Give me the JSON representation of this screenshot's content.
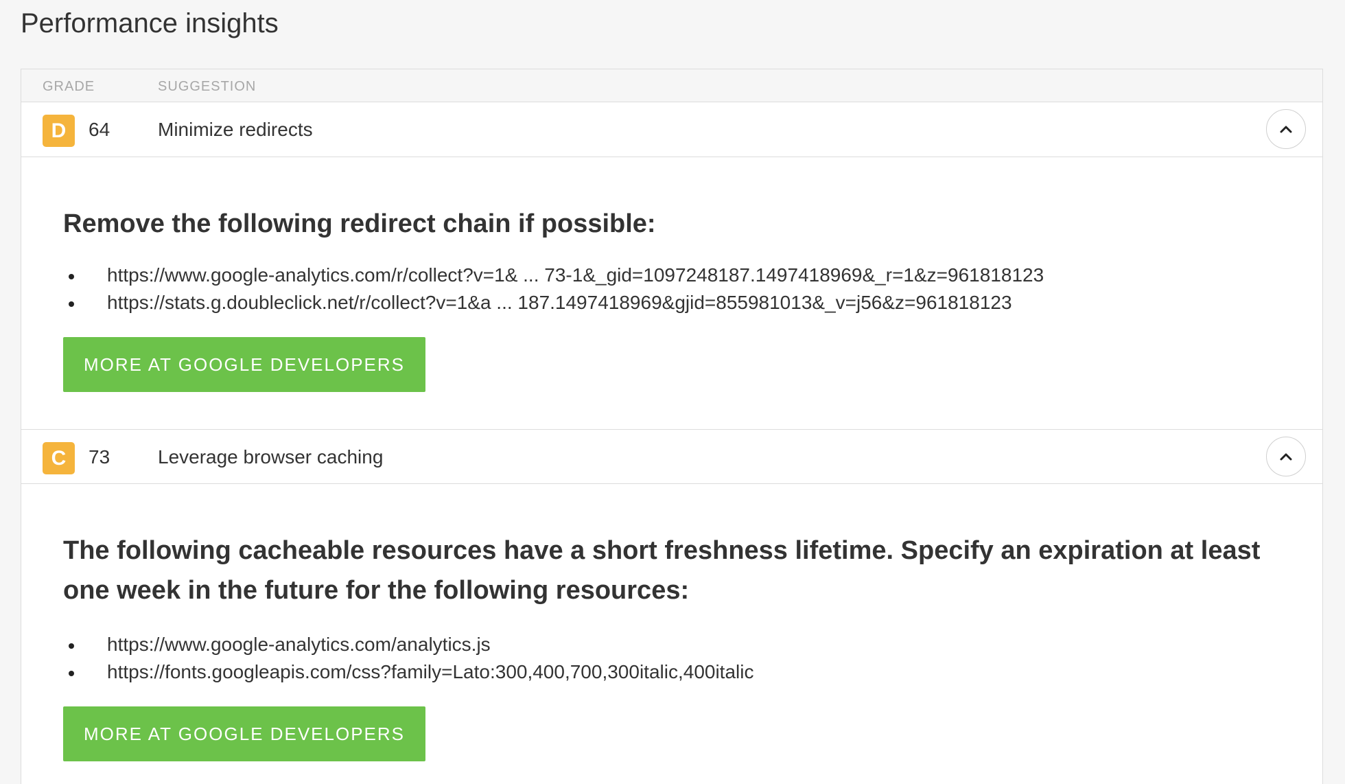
{
  "page_title": "Performance insights",
  "table": {
    "headers": {
      "grade": "GRADE",
      "suggestion": "SUGGESTION"
    },
    "rows": [
      {
        "grade": "D",
        "score": "64",
        "suggestion": "Minimize redirects",
        "expanded": true,
        "detail_heading": "Remove the following redirect chain if possible:",
        "urls": [
          "https://www.google-analytics.com/r/collect?v=1& ... 73-1&_gid=1097248187.1497418969&_r=1&z=961818123",
          "https://stats.g.doubleclick.net/r/collect?v=1&a ... 187.1497418969&gjid=855981013&_v=j56&z=961818123"
        ],
        "button_label": "MORE AT GOOGLE DEVELOPERS"
      },
      {
        "grade": "C",
        "score": "73",
        "suggestion": "Leverage browser caching",
        "expanded": true,
        "detail_heading": "The following cacheable resources have a short freshness lifetime. Specify an expiration at least one week in the future for the following resources:",
        "urls": [
          "https://www.google-analytics.com/analytics.js",
          "https://fonts.googleapis.com/css?family=Lato:300,400,700,300italic,400italic"
        ],
        "button_label": "MORE AT GOOGLE DEVELOPERS"
      }
    ]
  },
  "colors": {
    "grade_badge": "#f5b43c",
    "button": "#6cc24a",
    "background": "#f6f6f6",
    "border": "#dcdcdc"
  },
  "icons": {
    "toggle": "chevron-up-icon"
  }
}
